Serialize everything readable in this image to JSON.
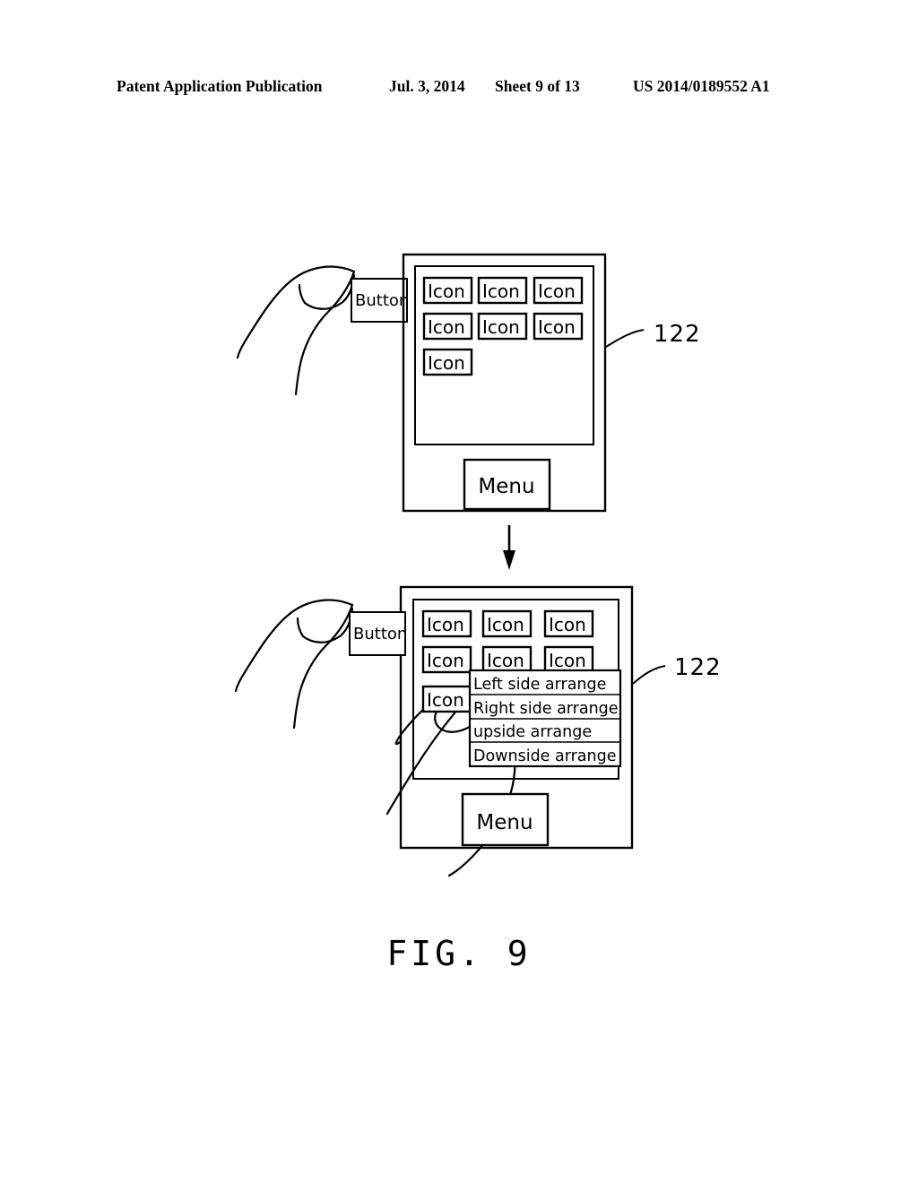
{
  "header": {
    "publication": "Patent Application Publication",
    "date": "Jul. 3, 2014",
    "sheet": "Sheet 9 of 13",
    "patent_number": "US 2014/0189552 A1"
  },
  "figure": {
    "caption": "FIG. 9",
    "line_color": "#000000",
    "background": "#ffffff"
  },
  "top_device": {
    "reference_numeral": "122",
    "button_label": "Button",
    "menu_button_label": "Menu",
    "icons": [
      {
        "label": "Icon"
      },
      {
        "label": "Icon"
      },
      {
        "label": "Icon"
      },
      {
        "label": "Icon"
      },
      {
        "label": "Icon"
      },
      {
        "label": "Icon"
      },
      {
        "label": "Icon"
      }
    ]
  },
  "bottom_device": {
    "reference_numeral": "122",
    "button_label": "Button",
    "menu_button_label": "Menu",
    "icons": [
      {
        "label": "Icon"
      },
      {
        "label": "Icon"
      },
      {
        "label": "Icon"
      },
      {
        "label": "Icon"
      },
      {
        "label": "Icon"
      },
      {
        "label": "Icon"
      },
      {
        "label": "Icon"
      }
    ],
    "popup_menu": {
      "items": [
        {
          "label": "Left  side  arrange"
        },
        {
          "label": "Right  side  arrange"
        },
        {
          "label": "upside  arrange"
        },
        {
          "label": "Downside    arrange"
        }
      ]
    }
  }
}
